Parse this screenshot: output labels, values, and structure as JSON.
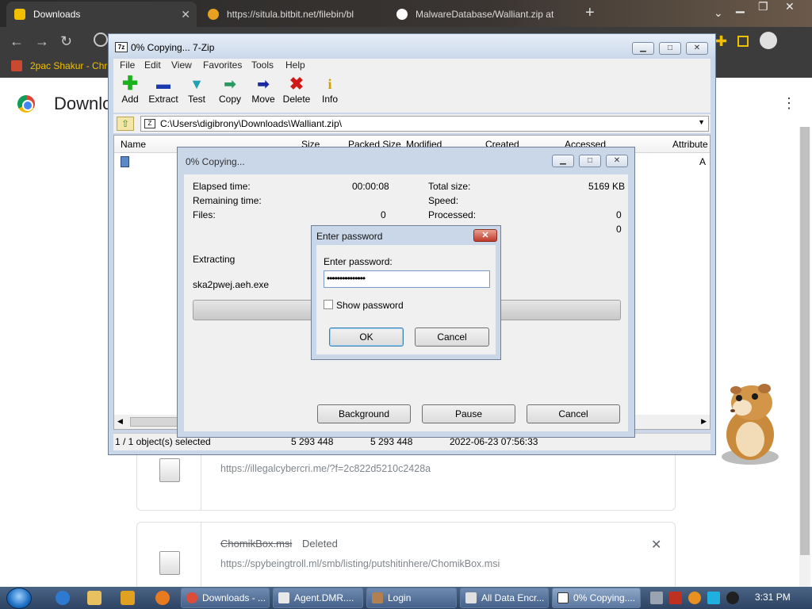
{
  "browser": {
    "tabs": [
      {
        "label": "Downloads",
        "active": true
      },
      {
        "label": "https://situla.bitbit.net/filebin/bl",
        "active": false
      },
      {
        "label": "MalwareDatabase/Walliant.zip at",
        "active": false
      }
    ],
    "bookmark": "2pac Shakur - Chro",
    "page_title": "Downlo",
    "downloads": [
      {
        "url": "https://illegalcybercri.me/?f=2c822d5210c2428a"
      },
      {
        "name": "ChomikBox.msi",
        "status": "Deleted",
        "url": "https://spybeingtroll.ml/smb/listing/putshitinhere/ChomikBox.msi"
      }
    ]
  },
  "zip": {
    "title": "0% Copying... 7-Zip",
    "menu": [
      "File",
      "Edit",
      "View",
      "Favorites",
      "Tools",
      "Help"
    ],
    "toolbar": [
      "Add",
      "Extract",
      "Test",
      "Copy",
      "Move",
      "Delete",
      "Info"
    ],
    "path": "C:\\Users\\digibrony\\Downloads\\Walliant.zip\\",
    "columns": [
      "Name",
      "Size",
      "Packed Size",
      "Modified",
      "Created",
      "Accessed",
      "Attribute"
    ],
    "row_attr": "A",
    "status": {
      "selected": "1 / 1 object(s) selected",
      "size": "5 293 448",
      "packed": "5 293 448",
      "modified": "2022-06-23 07:56:33"
    }
  },
  "copy_dialog": {
    "title": "0% Copying...",
    "elapsed_label": "Elapsed time:",
    "elapsed_value": "00:00:08",
    "remaining_label": "Remaining time:",
    "files_label": "Files:",
    "files_value": "0",
    "total_label": "Total size:",
    "total_value": "5169 KB",
    "speed_label": "Speed:",
    "processed_label": "Processed:",
    "processed_value": "0",
    "extra_value": "0",
    "action": "Extracting",
    "filename": "ska2pwej.aeh.exe",
    "progress": 0,
    "buttons": {
      "background": "Background",
      "pause": "Pause",
      "cancel": "Cancel"
    }
  },
  "password_dialog": {
    "title": "Enter password",
    "prompt": "Enter password:",
    "value": "•••••••••••••••",
    "show_password": "Show password",
    "ok": "OK",
    "cancel": "Cancel"
  },
  "taskbar": {
    "items": [
      {
        "label": "Downloads - ...",
        "color": "#dd4b39"
      },
      {
        "label": "Agent.DMR....",
        "color": "#e8e8e8"
      },
      {
        "label": "Login",
        "color": "#b08050"
      },
      {
        "label": "All Data Encr...",
        "color": "#e0e0e0"
      },
      {
        "label": "0% Copying....",
        "color": "#ffffff"
      }
    ],
    "time": "3:31 PM"
  }
}
